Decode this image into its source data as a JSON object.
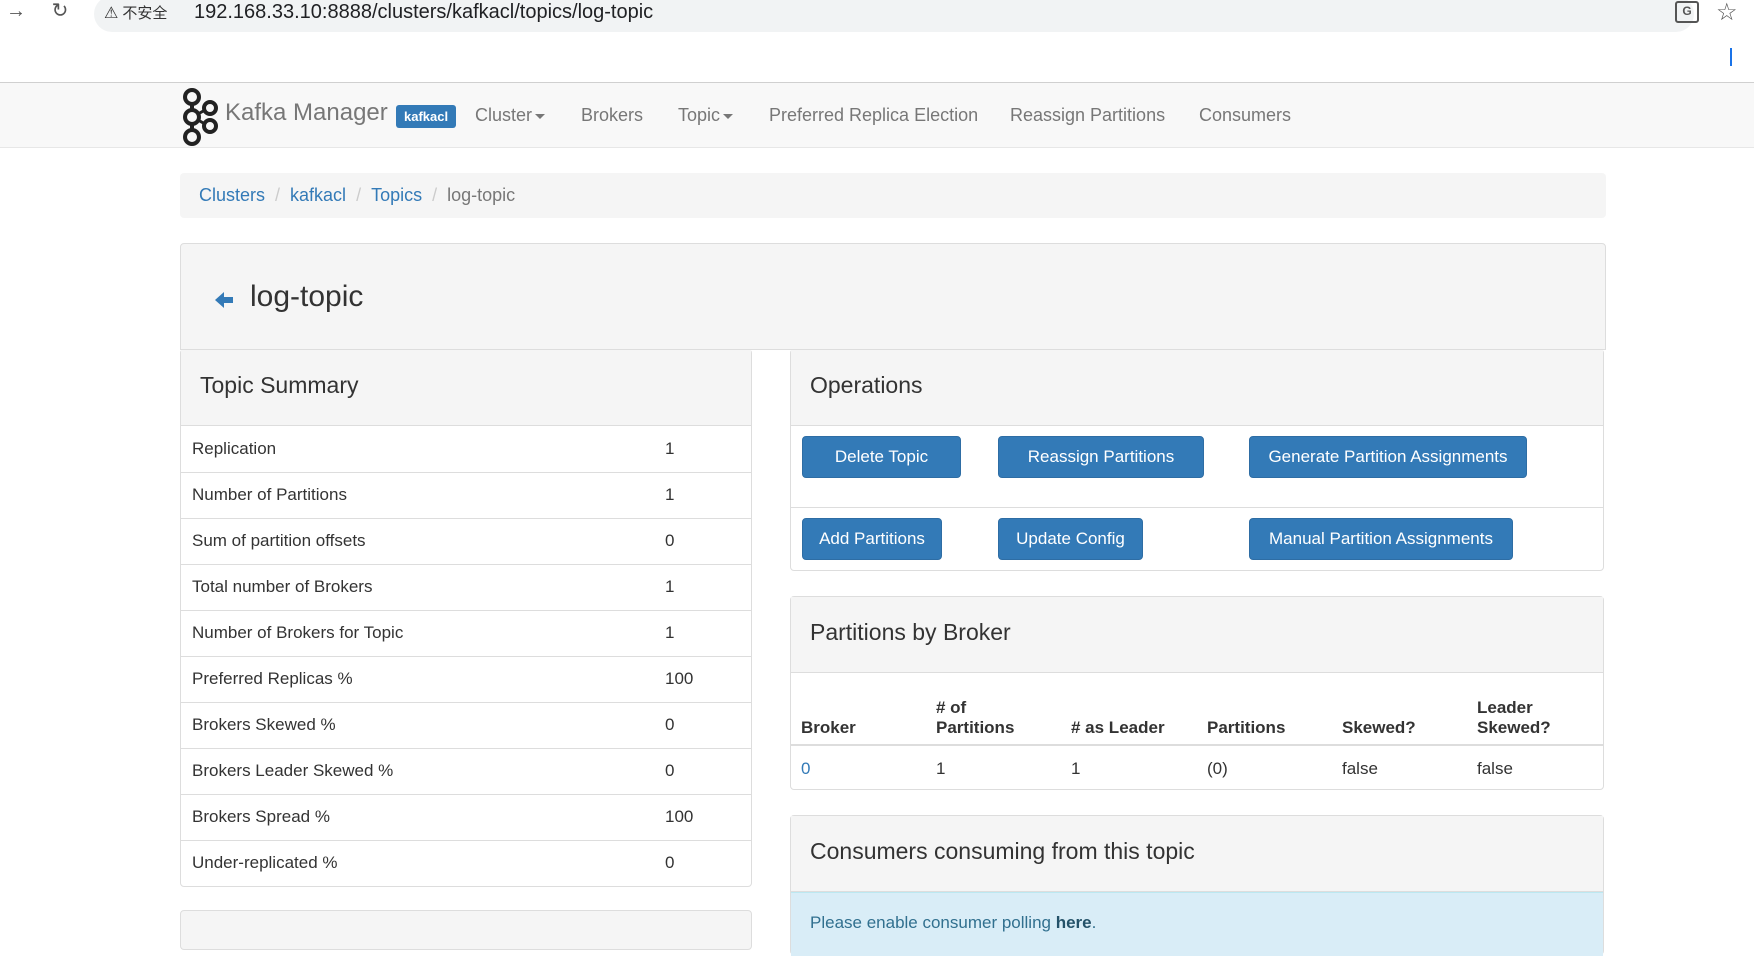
{
  "browser": {
    "insecure_label": "不安全",
    "url": "192.168.33.10:8888/clusters/kafkacl/topics/log-topic"
  },
  "navbar": {
    "brand": "Kafka Manager",
    "cluster_badge": "kafkacl",
    "items": [
      {
        "label": "Cluster",
        "dropdown": true
      },
      {
        "label": "Brokers",
        "dropdown": false
      },
      {
        "label": "Topic",
        "dropdown": true
      },
      {
        "label": "Preferred Replica Election",
        "dropdown": false
      },
      {
        "label": "Reassign Partitions",
        "dropdown": false
      },
      {
        "label": "Consumers",
        "dropdown": false
      }
    ]
  },
  "breadcrumb": {
    "items": [
      "Clusters",
      "kafkacl",
      "Topics"
    ],
    "active": "log-topic",
    "separator": "/"
  },
  "page": {
    "title": "log-topic"
  },
  "summary": {
    "title": "Topic Summary",
    "rows": [
      {
        "label": "Replication",
        "value": "1"
      },
      {
        "label": "Number of Partitions",
        "value": "1"
      },
      {
        "label": "Sum of partition offsets",
        "value": "0"
      },
      {
        "label": "Total number of Brokers",
        "value": "1"
      },
      {
        "label": "Number of Brokers for Topic",
        "value": "1"
      },
      {
        "label": "Preferred Replicas %",
        "value": "100"
      },
      {
        "label": "Brokers Skewed %",
        "value": "0"
      },
      {
        "label": "Brokers Leader Skewed %",
        "value": "0"
      },
      {
        "label": "Brokers Spread %",
        "value": "100"
      },
      {
        "label": "Under-replicated %",
        "value": "0"
      }
    ]
  },
  "operations": {
    "title": "Operations",
    "buttons": {
      "delete_topic": "Delete Topic",
      "reassign_partitions": "Reassign Partitions",
      "generate_assignments": "Generate Partition Assignments",
      "add_partitions": "Add Partitions",
      "update_config": "Update Config",
      "manual_assignments": "Manual Partition Assignments"
    }
  },
  "partitions_by_broker": {
    "title": "Partitions by Broker",
    "headers": {
      "broker": "Broker",
      "num_partitions_1": "# of",
      "num_partitions_2": "Partitions",
      "as_leader": "# as Leader",
      "partitions": "Partitions",
      "skewed": "Skewed?",
      "leader_skewed_1": "Leader",
      "leader_skewed_2": "Skewed?"
    },
    "rows": [
      {
        "broker": "0",
        "num_partitions": "1",
        "as_leader": "1",
        "partitions": "(0)",
        "skewed": "false",
        "leader_skewed": "false"
      }
    ]
  },
  "consumers": {
    "title": "Consumers consuming from this topic",
    "message_prefix": "Please enable consumer polling ",
    "message_link": "here",
    "message_suffix": "."
  },
  "colors": {
    "primary": "#337ab7",
    "info_bg": "#d9edf7",
    "panel_heading_bg": "#f5f5f5"
  }
}
